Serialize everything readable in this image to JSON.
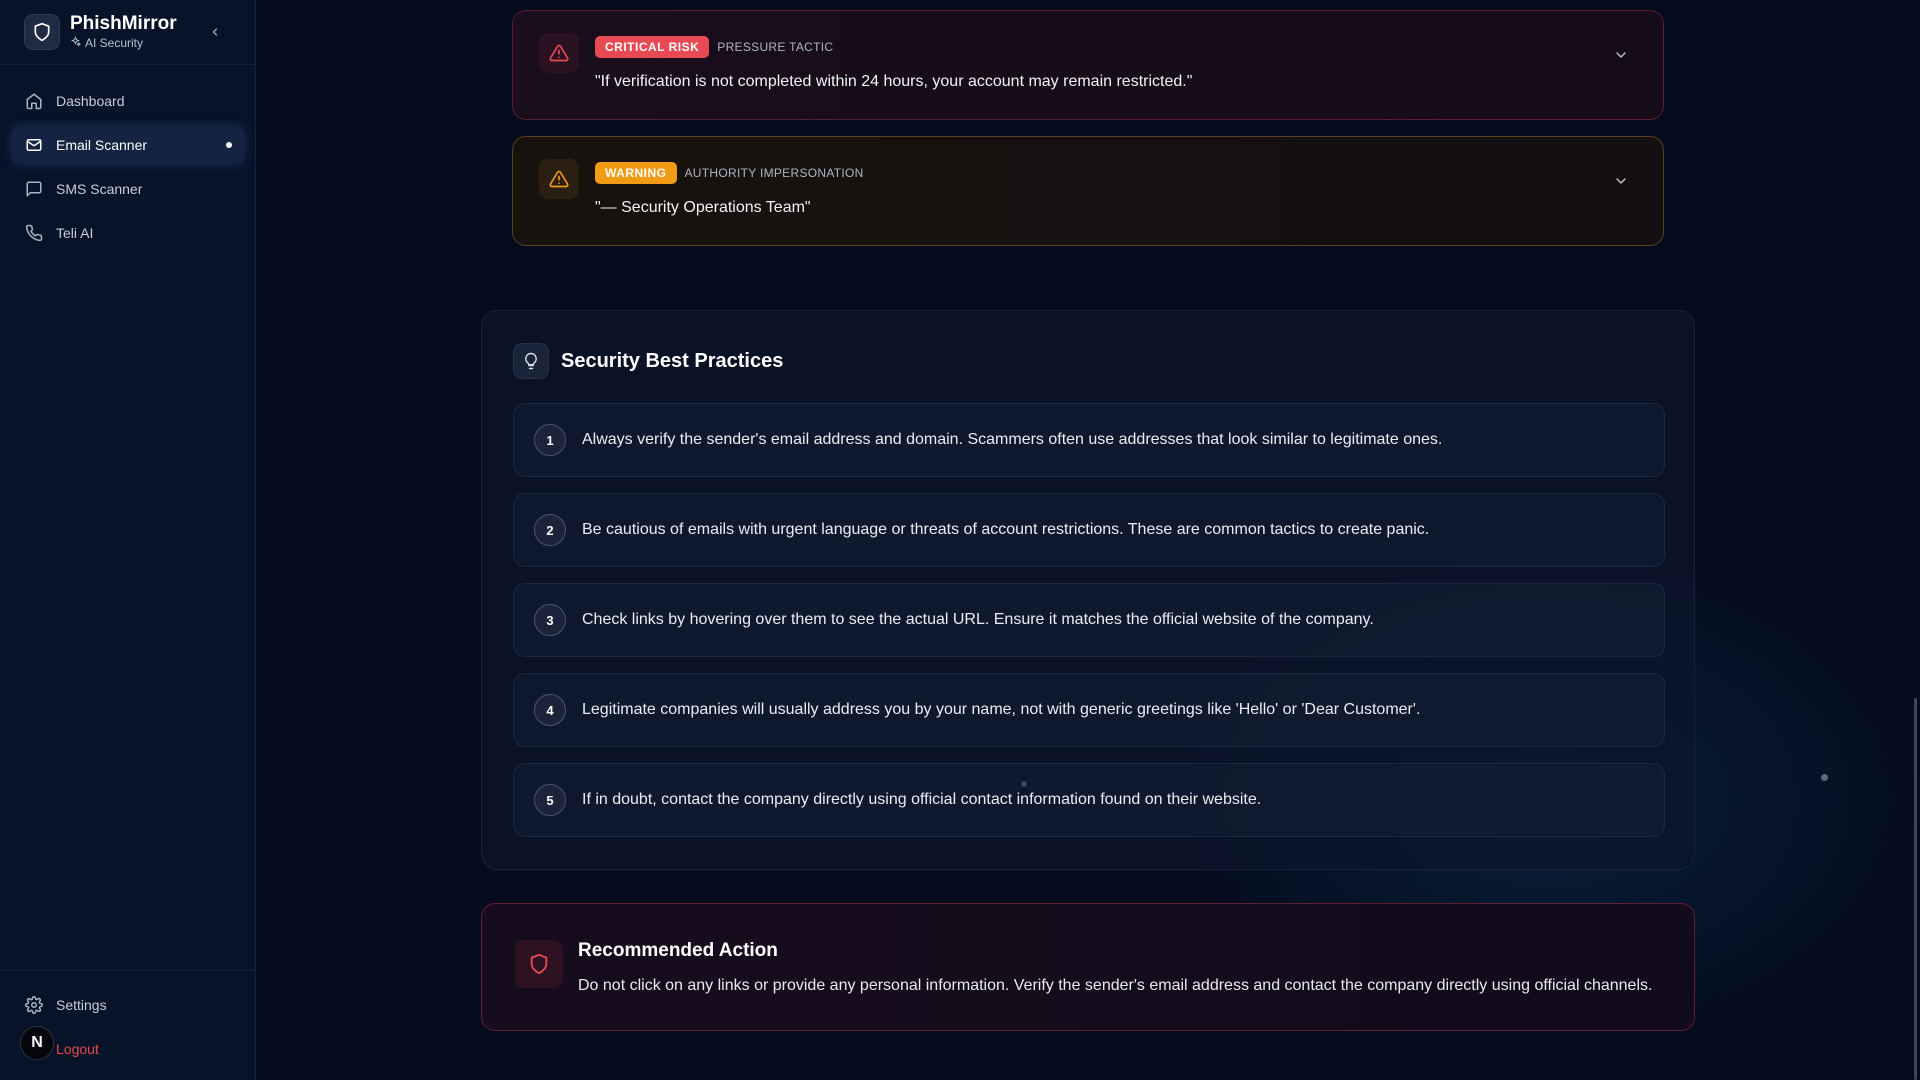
{
  "sidebar": {
    "brand_name": "PhishMirror",
    "brand_sub": "AI Security",
    "items": [
      {
        "label": "Dashboard",
        "icon": "home-icon"
      },
      {
        "label": "Email Scanner",
        "icon": "mail-icon",
        "active": true
      },
      {
        "label": "SMS Scanner",
        "icon": "message-icon"
      },
      {
        "label": "Teli AI",
        "icon": "phone-icon"
      }
    ],
    "settings_label": "Settings",
    "logout_label": "Logout",
    "avatar_initial": "N"
  },
  "alerts": [
    {
      "severity": "CRITICAL RISK",
      "category": "PRESSURE TACTIC",
      "quote": "\"If verification is not completed within 24 hours, your account may remain restricted.\"",
      "color": "#e84a54"
    },
    {
      "severity": "WARNING",
      "category": "AUTHORITY IMPERSONATION",
      "quote": "\"— Security Operations Team\"",
      "color": "#f19a14"
    }
  ],
  "practices": {
    "title": "Security Best Practices",
    "items": [
      {
        "num": "1",
        "text": "Always verify the sender's email address and domain. Scammers often use addresses that look similar to legitimate ones."
      },
      {
        "num": "2",
        "text": "Be cautious of emails with urgent language or threats of account restrictions. These are common tactics to create panic."
      },
      {
        "num": "3",
        "text": "Check links by hovering over them to see the actual URL. Ensure it matches the official website of the company."
      },
      {
        "num": "4",
        "text": "Legitimate companies will usually address you by your name, not with generic greetings like 'Hello' or 'Dear Customer'."
      },
      {
        "num": "5",
        "text": "If in doubt, contact the company directly using official contact information found on their website."
      }
    ]
  },
  "recommendation": {
    "title": "Recommended Action",
    "text": "Do not click on any links or provide any personal information. Verify the sender's email address and contact the company directly using official channels.",
    "color": "#e84a54"
  }
}
